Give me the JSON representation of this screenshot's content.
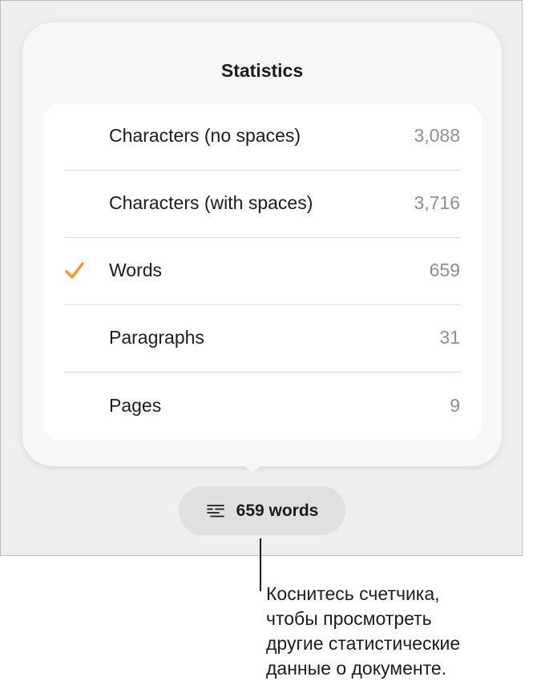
{
  "popover": {
    "title": "Statistics"
  },
  "stats": [
    {
      "label": "Characters (no spaces)",
      "value": "3,088",
      "selected": false
    },
    {
      "label": "Characters (with spaces)",
      "value": "3,716",
      "selected": false
    },
    {
      "label": "Words",
      "value": "659",
      "selected": true
    },
    {
      "label": "Paragraphs",
      "value": "31",
      "selected": false
    },
    {
      "label": "Pages",
      "value": "9",
      "selected": false
    }
  ],
  "counter_button": {
    "label": "659 words",
    "icon": "text-lines-icon"
  },
  "callout": {
    "line1": "Коснитесь счетчика,",
    "line2": "чтобы просмотреть",
    "line3": "другие статистические",
    "line4": "данные о документе."
  },
  "colors": {
    "accent_check": "#f7931e",
    "value_gray": "#8e8e93"
  }
}
